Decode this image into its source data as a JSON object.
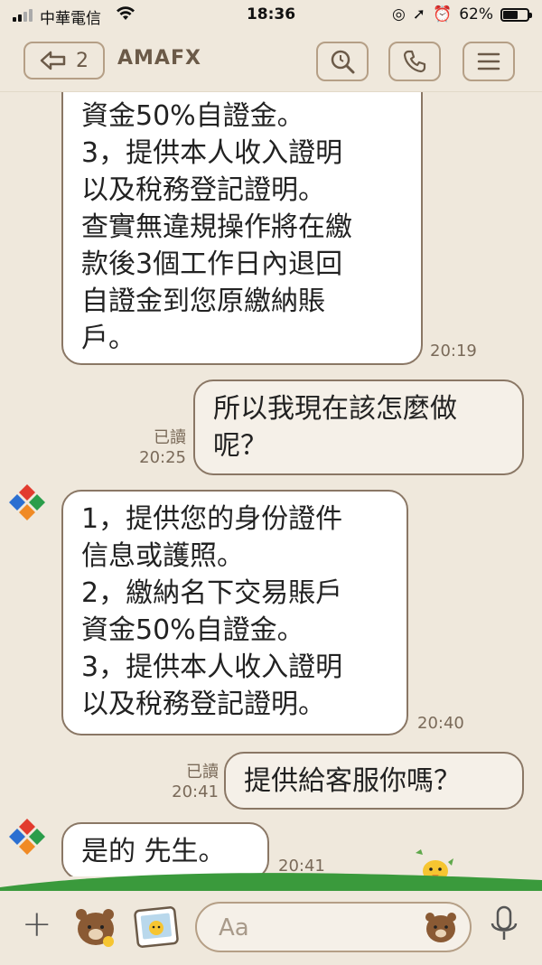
{
  "status_bar": {
    "carrier": "中華電信",
    "time": "18:36",
    "battery": "62%"
  },
  "header": {
    "back_count": "2",
    "title": "AMAFX"
  },
  "messages": [
    {
      "side": "left",
      "text": "資金50%自證金。\n3，提供本人收入證明\n以及稅務登記證明。\n查實無違規操作將在繳\n款後3個工作日內退回\n自證金到您原繳納賬\n戶。",
      "time": "20:19"
    },
    {
      "side": "right",
      "text": "所以我現在該怎麼做\n呢？",
      "read": "已讀",
      "time": "20:25"
    },
    {
      "side": "left",
      "text": "1，提供您的身份證件\n信息或護照。\n2，繳納名下交易賬戶\n資金50%自證金。\n3，提供本人收入證明\n以及稅務登記證明。",
      "time": "20:40"
    },
    {
      "side": "right",
      "text": "提供給客服你嗎？",
      "read": "已讀",
      "time": "20:41"
    },
    {
      "side": "left",
      "text": "是的 先生。",
      "time": "20:41"
    }
  ],
  "input": {
    "placeholder": "Aa"
  },
  "colors": {
    "background": "#efe8dc",
    "border": "#8a7765",
    "accent": "#6b5a48"
  }
}
